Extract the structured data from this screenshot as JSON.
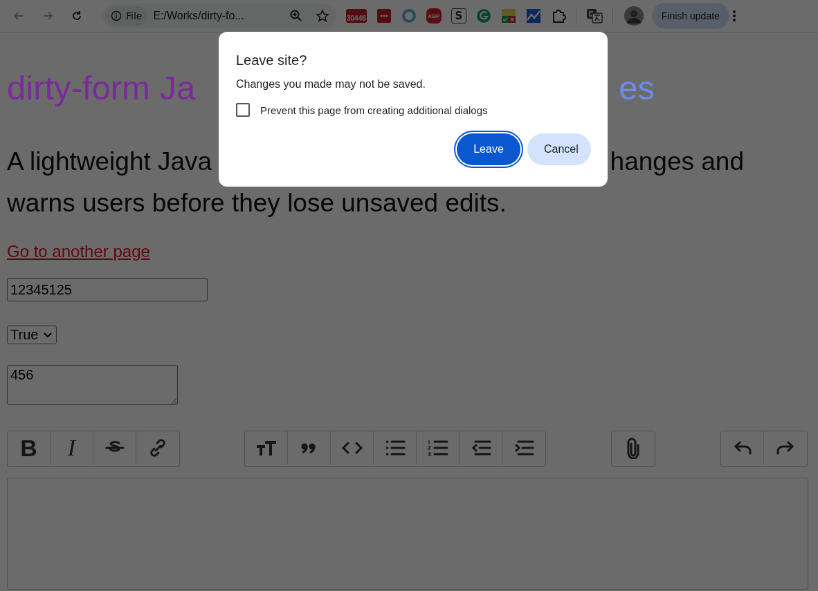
{
  "browser": {
    "nav_buttons": [
      {
        "kind": "back",
        "disabled": true
      },
      {
        "kind": "forward",
        "disabled": true
      },
      {
        "kind": "reload",
        "disabled": false
      }
    ],
    "address": {
      "scheme": "File",
      "url": "E:/Works/dirty-fo..."
    },
    "extensions": [
      {
        "kind": "badge",
        "text": "30446"
      },
      {
        "kind": "dots"
      },
      {
        "kind": "ring"
      },
      {
        "kind": "octagon",
        "text": "ABP"
      },
      {
        "kind": "letter",
        "text": "S"
      },
      {
        "kind": "grammar"
      },
      {
        "kind": "checklist"
      },
      {
        "kind": "chart"
      },
      {
        "kind": "puzzle"
      },
      {
        "kind": "translate"
      }
    ],
    "update_button": "Finish update"
  },
  "page": {
    "heading_parts": [
      "dirty-form Ja",
      "es"
    ],
    "intro_parts": [
      "A lightweight Java",
      "hanges and"
    ],
    "intro_line2": "warns users before they lose unsaved edits.",
    "link": "Go to another page",
    "text_input": {
      "value": "12345125"
    },
    "select": {
      "value": "True"
    },
    "textarea": {
      "value": "456"
    },
    "editor_toolbar": [
      {
        "buttons": [
          {
            "kind": "bold",
            "label": "B"
          },
          {
            "kind": "italic",
            "label": "I"
          },
          {
            "kind": "strike"
          },
          {
            "kind": "link"
          }
        ]
      },
      {
        "buttons": [
          {
            "kind": "heading"
          },
          {
            "kind": "quote"
          },
          {
            "kind": "code"
          },
          {
            "kind": "bullets"
          },
          {
            "kind": "numbers"
          },
          {
            "kind": "outdent"
          },
          {
            "kind": "indent"
          }
        ]
      },
      {
        "buttons": [
          {
            "kind": "attach"
          }
        ]
      },
      {
        "buttons": [
          {
            "kind": "undo"
          },
          {
            "kind": "redo"
          }
        ]
      }
    ]
  },
  "dialog": {
    "title": "Leave site?",
    "message": "Changes you made may not be saved.",
    "checkbox": {
      "label": "Prevent this page from creating additional dialogs",
      "checked": false
    },
    "buttons": [
      {
        "label": "Leave",
        "kind": "primary"
      },
      {
        "label": "Cancel",
        "kind": "secondary"
      }
    ]
  }
}
